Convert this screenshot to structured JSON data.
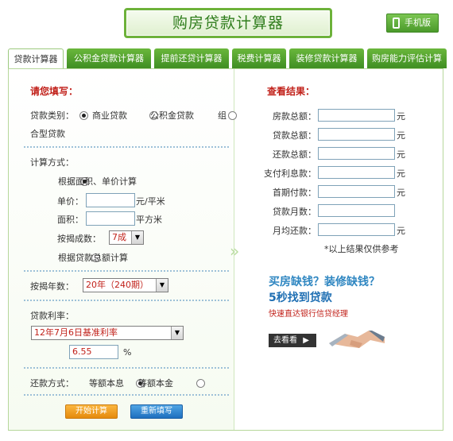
{
  "header": {
    "title": "购房贷款计算器",
    "mobile_label": "手机版"
  },
  "tabs": [
    {
      "label": "贷款计算器",
      "active": true
    },
    {
      "label": "公积金贷款计算器",
      "active": false
    },
    {
      "label": "提前还贷计算器",
      "active": false
    },
    {
      "label": "税费计算器",
      "active": false
    },
    {
      "label": "装修贷款计算器",
      "active": false
    },
    {
      "label": "购房能力评估计算",
      "active": false
    }
  ],
  "form": {
    "heading": "请您填写：",
    "loan_type_label": "贷款类别：",
    "loan_types": [
      "商业贷款",
      "公积金贷款",
      "组",
      "合型贷款"
    ],
    "calc_method_label": "计算方式：",
    "method_area": "根据面积、单价计算",
    "unit_price_label": "单价：",
    "unit_price_unit": "元/平米",
    "area_label": "面积：",
    "area_unit": "平方米",
    "ratio_label": "按揭成数：",
    "ratio_value": "7成",
    "method_total": "根据贷款总额计算",
    "years_label": "按揭年数：",
    "years_value": "20年（240期）",
    "rate_label": "贷款利率：",
    "rate_option": "12年7月6日基准利率",
    "rate_value": "6.55",
    "rate_unit": "%",
    "repay_label": "还款方式：",
    "repay_equal_interest": "等额本息",
    "repay_equal_principal": "等额本金",
    "calc_button": "开始计算",
    "reset_button": "重新填写"
  },
  "results": {
    "heading": "查看结果：",
    "rows": [
      {
        "label": "房款总额：",
        "unit": "元"
      },
      {
        "label": "贷款总额：",
        "unit": "元"
      },
      {
        "label": "还款总额：",
        "unit": "元"
      },
      {
        "label": "支付利息款：",
        "unit": "元"
      },
      {
        "label": "首期付款：",
        "unit": "元"
      },
      {
        "label": "贷款月数：",
        "unit": ""
      },
      {
        "label": "月均还款：",
        "unit": "元"
      }
    ],
    "note": "*以上结果仅供参考"
  },
  "ad": {
    "line1": "买房缺钱？装修缺钱？",
    "line2": "5秒找到贷款",
    "line3": "快速直达银行信贷经理",
    "button": "去看看"
  },
  "colors": {
    "brand_green": "#4b9a2b",
    "heading_red": "#c1211a",
    "ad_blue": "#2e86c1"
  }
}
